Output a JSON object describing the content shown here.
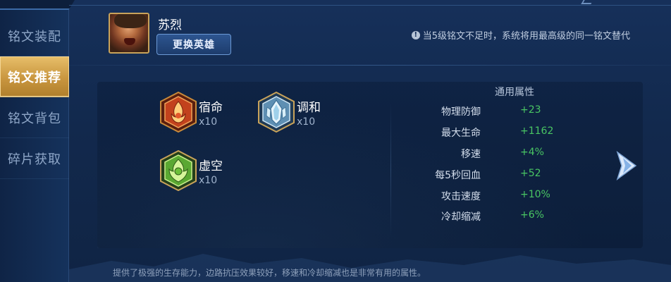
{
  "sidebar": {
    "items": [
      {
        "label": "铭文装配"
      },
      {
        "label": "铭文推荐"
      },
      {
        "label": "铭文背包"
      },
      {
        "label": "碎片获取"
      }
    ],
    "active_index": 1
  },
  "hero": {
    "name": "苏烈",
    "change_label": "更换英雄"
  },
  "notice": {
    "icon": "info-icon",
    "text": "当5级铭文不足时，系统将用最高级的同一铭文替代"
  },
  "runes": [
    {
      "name": "宿命",
      "count": "x10",
      "color": "#d9542a",
      "icon": "red-rune-icon"
    },
    {
      "name": "调和",
      "count": "x10",
      "color": "#8fc4e0",
      "icon": "blue-rune-icon"
    },
    {
      "name": "虚空",
      "count": "x10",
      "color": "#6fb43a",
      "icon": "green-rune-icon"
    }
  ],
  "stats": {
    "title": "通用属性",
    "rows": [
      {
        "label": "物理防御",
        "value": "+23"
      },
      {
        "label": "最大生命",
        "value": "+1162"
      },
      {
        "label": "移速",
        "value": "+4%"
      },
      {
        "label": "每5秒回血",
        "value": "+52"
      },
      {
        "label": "攻击速度",
        "value": "+10%"
      },
      {
        "label": "冷却缩减",
        "value": "+6%"
      }
    ]
  },
  "footer": {
    "description": "提供了极强的生存能力，边路抗压效果较好，移速和冷却缩减也是非常有用的属性。"
  },
  "colors": {
    "accent_gold": "#d4a24c",
    "value_green": "#49c563",
    "background": "#14305a"
  }
}
